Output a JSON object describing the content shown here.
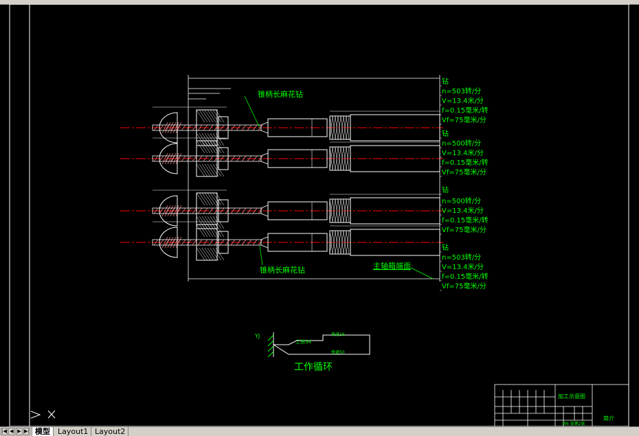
{
  "drawing": {
    "labels": {
      "drill_top": "锥柄长麻花钻",
      "drill_bottom": "锥柄长麻花钻",
      "spindle_box": "主轴箱端面",
      "cycle_title": "工作循环",
      "cycle_yj": "YJ",
      "cycle_work": "工进34",
      "cycle_fast_fwd": "快进16",
      "cycle_fast_back": "快退50"
    },
    "params": [
      {
        "tool": "钻",
        "n": "n=503转/分",
        "v": "V=13.4米/分",
        "f": "f=0.15毫米/转",
        "vf": "Vf=75毫米/分"
      },
      {
        "tool": "钻",
        "n": "n=500转/分",
        "v": "V=13.4米/分",
        "f": "f=0.15毫米/转",
        "vf": "Vf=75毫米/分"
      },
      {
        "tool": "钻",
        "n": "n=500转/分",
        "v": "V=13.4米/分",
        "f": "f=0.15毫米/转",
        "vf": "Vf=75毫米/分"
      },
      {
        "tool": "钻",
        "n": "n=503转/分",
        "v": "V=13.4米/分",
        "f": "f=0.15毫米/转",
        "vf": "Vf=75毫米/分"
      }
    ],
    "title_block": {
      "drawing_name": "加工示意图",
      "cell_note": "简介",
      "sheet_info": "共6 张第2张"
    },
    "colors": {
      "geometry": "#ffffff",
      "text": "#00ff00",
      "centerline": "#ff0000",
      "hatch": "#ff8c8c"
    }
  },
  "ui": {
    "tabs": [
      {
        "label": "模型",
        "active": true
      },
      {
        "label": "Layout1",
        "active": false
      },
      {
        "label": "Layout2",
        "active": false
      }
    ]
  }
}
